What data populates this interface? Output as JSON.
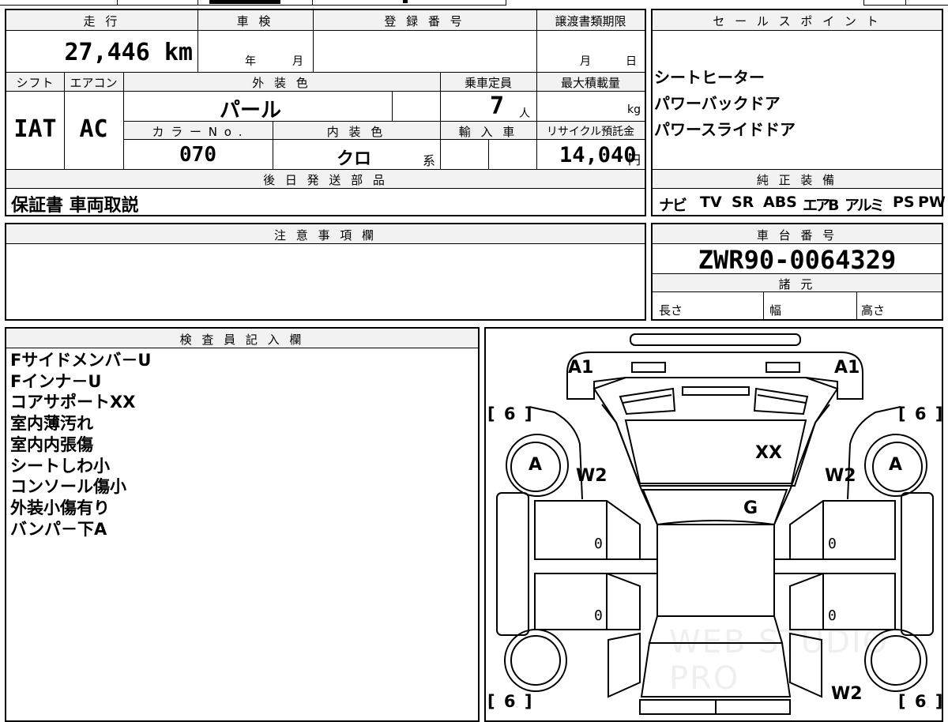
{
  "main_info": {
    "headers": {
      "mileage": "走 行",
      "inspection": "車 検",
      "registration_number": "登 録 番 号",
      "transfer_deadline": "譲渡書類期限",
      "shift": "シフト",
      "aircon": "エアコン",
      "exterior_color": "外 装 色",
      "capacity": "乗車定員",
      "max_load": "最大積載量",
      "color_no": "カ ラ ー N o .",
      "interior_color": "内 装 色",
      "import": "輸 入 車",
      "recycle_fee": "リサイクル預託金",
      "later_parts": "後 日 発 送 部 品"
    },
    "values": {
      "mileage": "27,446 km",
      "inspection_year_unit": "年",
      "inspection_month_unit": "月",
      "transfer_month_unit": "月",
      "transfer_day_unit": "日",
      "shift": "IAT",
      "aircon": "AC",
      "exterior_color": "パール",
      "capacity": "7",
      "capacity_unit": "人",
      "max_load_unit": "kg",
      "color_no": "070",
      "interior_color": "クロ",
      "interior_suffix": "系",
      "recycle_fee": "14,040",
      "recycle_unit": "円",
      "later_parts": "保証書 車両取説"
    }
  },
  "sales_points": {
    "header": "セ ー ル ス ポ イ ン ト",
    "items": [
      "シートヒーター",
      "パワーバックドア",
      "パワースライドドア"
    ]
  },
  "genuine_equipment": {
    "header": "純 正 装 備",
    "items": [
      "ナビ",
      "TV",
      "SR",
      "ABS",
      "エアB",
      "アルミ",
      "PS",
      "PW"
    ]
  },
  "notes": {
    "header": "注 意 事 項 欄"
  },
  "chassis": {
    "header": "車 台 番 号",
    "number": "ZWR90-0064329",
    "spec_header": "諸 元",
    "length_label": "長さ",
    "width_label": "幅",
    "height_label": "高さ"
  },
  "inspector": {
    "header": "検 査 員 記 入 欄",
    "lines": [
      "Fサイドメンバ－U",
      "Fインナ－U",
      "コアサポートXX",
      "室内薄汚れ",
      "室内内張傷",
      "シートしわ小",
      "コンソール傷小",
      "外装小傷有り",
      "バンパ－下A"
    ]
  },
  "diagram": {
    "marks": {
      "a1_left": "A1",
      "a1_right": "A1",
      "tire_fl": "[ 6 ]",
      "tire_fr": "[ 6 ]",
      "tire_rl": "[ 6 ]",
      "tire_rr": "[ 6 ]",
      "wheel_fl": "A",
      "wheel_fr": "A",
      "w2_left": "W2",
      "w2_right": "W2",
      "w2_rear": "W2",
      "hood": "XX",
      "windshield": "G",
      "door_fl": "0",
      "door_fr": "0",
      "door_rl": "0",
      "door_rr": "0"
    },
    "watermark": "WEB STUDIO PRO"
  }
}
